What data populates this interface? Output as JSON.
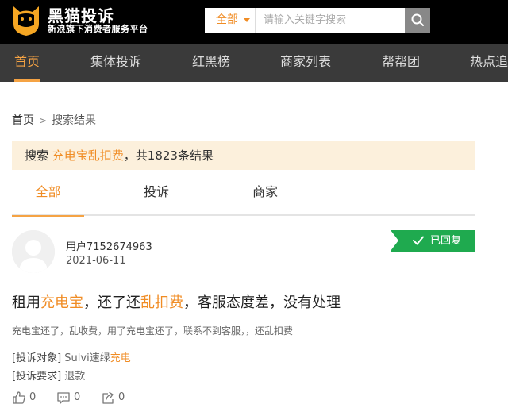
{
  "header": {
    "logo_title": "黑猫投诉",
    "logo_subtitle": "新浪旗下消费者服务平台",
    "search": {
      "scope": "全部",
      "placeholder": "请输入关键字搜索"
    }
  },
  "nav": {
    "items": [
      {
        "label": "首页",
        "active": true
      },
      {
        "label": "集体投诉",
        "active": false
      },
      {
        "label": "红黑榜",
        "active": false
      },
      {
        "label": "商家列表",
        "active": false
      },
      {
        "label": "帮帮团",
        "active": false
      },
      {
        "label": "热点追",
        "active": false
      }
    ]
  },
  "breadcrumb": {
    "home": "首页",
    "separator": ">",
    "current": "搜索结果"
  },
  "result_banner": {
    "prefix": "搜索 ",
    "keyword": "充电宝乱扣费",
    "suffix": "，共1823条结果"
  },
  "tabs": [
    {
      "label": "全部",
      "active": true
    },
    {
      "label": "投诉",
      "active": false
    },
    {
      "label": "商家",
      "active": false
    }
  ],
  "post": {
    "username": "用户7152674963",
    "date": "2021-06-11",
    "status": "已回复",
    "title_parts": [
      "租用",
      "充电宝",
      "，还了还",
      "乱扣费",
      "，客服态度差，没有处理"
    ],
    "summary": "充电宝还了，乱收费，用了充电宝还了，联系不到客服，，还乱扣费",
    "target_label": "[投诉对象]",
    "target_value_plain": "Sulvi速绿",
    "target_value_highlight": "充电",
    "request_label": "[投诉要求]",
    "request_value": "退款",
    "likes": "0",
    "comments": "0",
    "shares": "0"
  },
  "colors": {
    "accent_orange": "#f08c24",
    "nav_bg": "#3a3a3a",
    "status_green": "#1faa4f",
    "banner_bg": "#fcf0dc"
  },
  "icons": {
    "logo": "black-cat-icon",
    "search": "search-icon",
    "status": "check-icon",
    "like": "thumbs-up-icon",
    "comment": "comment-icon",
    "share": "share-icon"
  }
}
